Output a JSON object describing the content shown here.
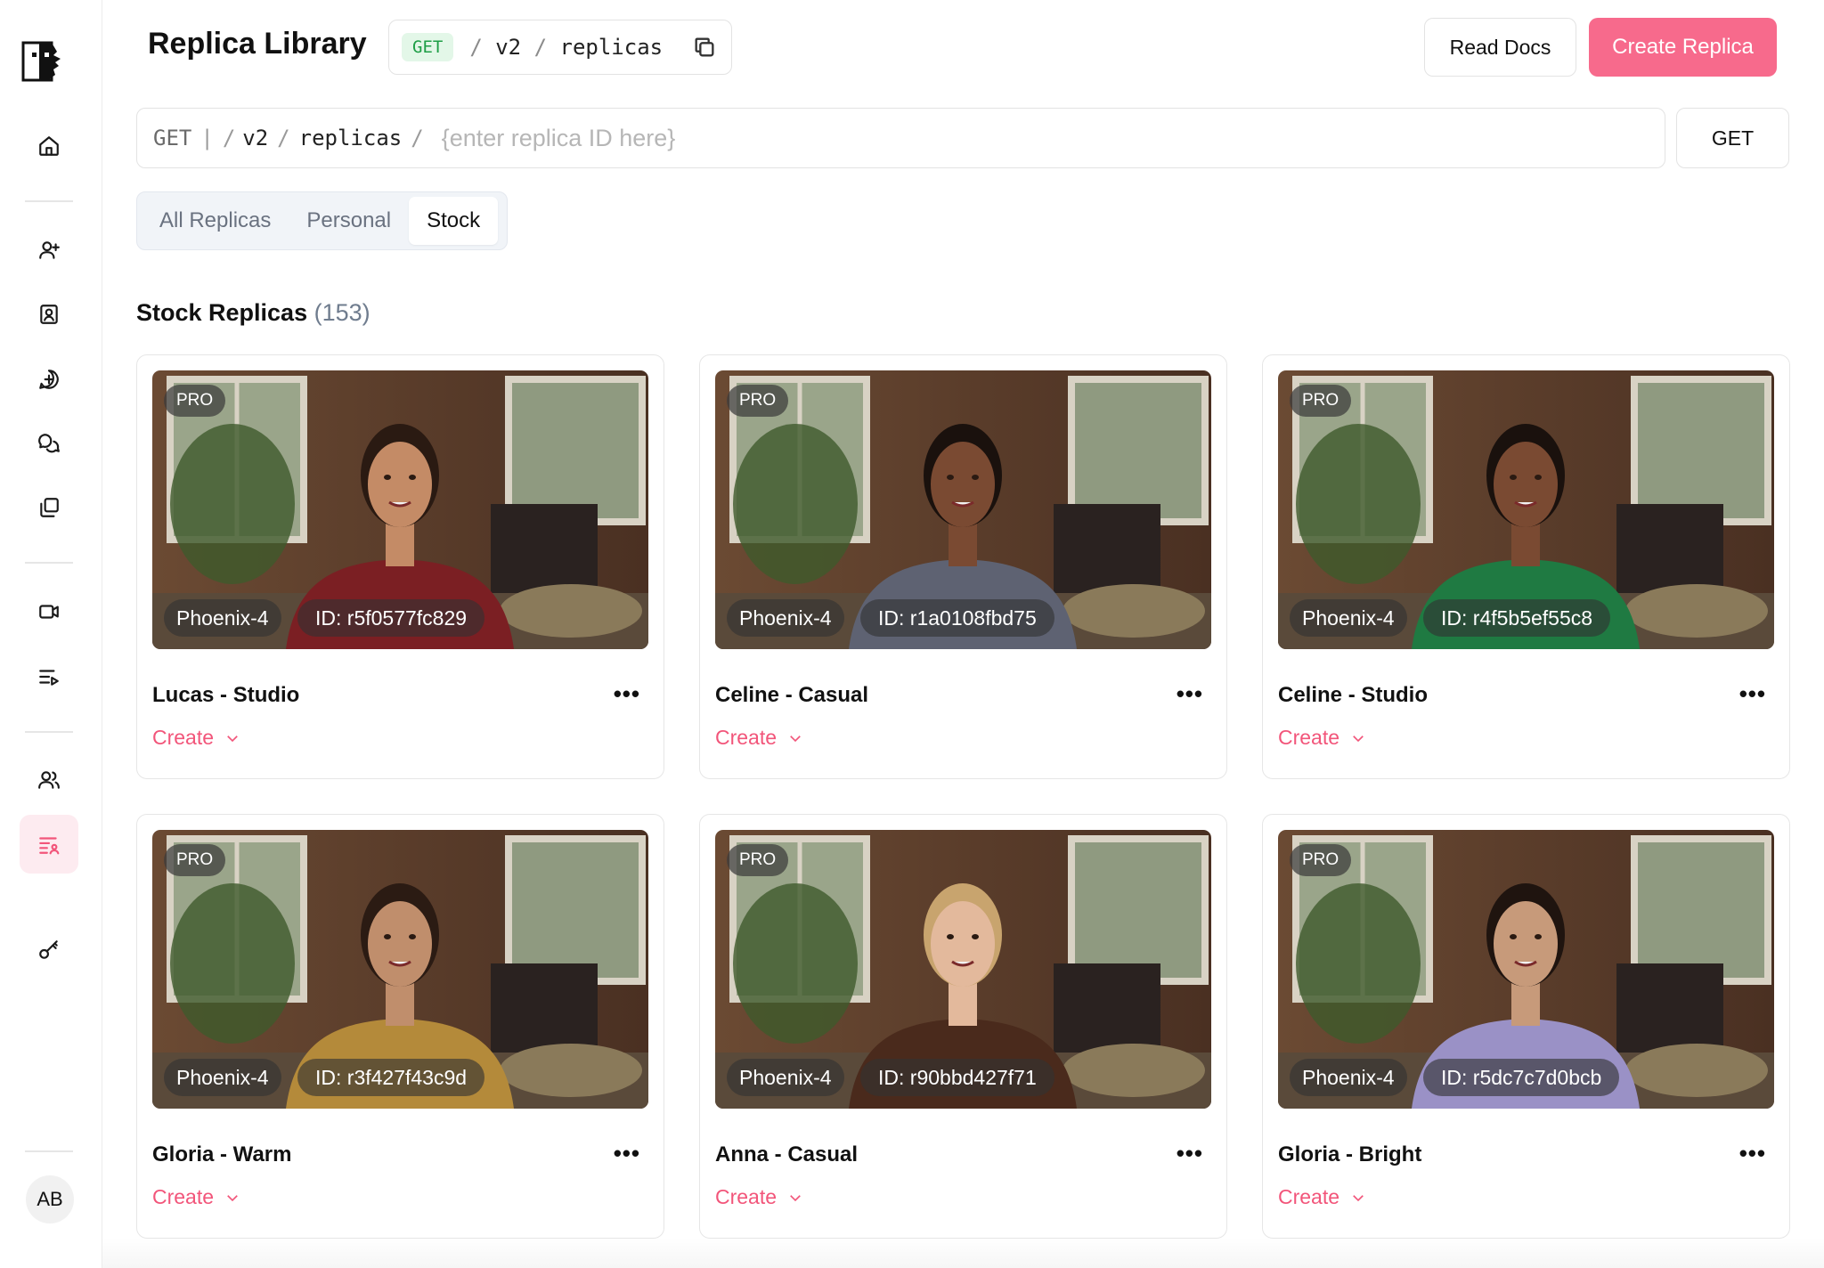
{
  "header": {
    "title": "Replica Library",
    "endpoint": {
      "method": "GET",
      "segments": [
        "v2",
        "replicas"
      ]
    },
    "read_docs_label": "Read Docs",
    "create_replica_label": "Create Replica"
  },
  "query": {
    "method": "GET",
    "pipe": "|",
    "segments": [
      "v2",
      "replicas"
    ],
    "placeholder": "{enter replica ID here}",
    "button_label": "GET"
  },
  "tabs": [
    {
      "label": "All Replicas",
      "active": false
    },
    {
      "label": "Personal",
      "active": false
    },
    {
      "label": "Stock",
      "active": true
    }
  ],
  "section": {
    "title": "Stock Replicas",
    "count": "(153)"
  },
  "cards": [
    {
      "name": "Lucas - Studio",
      "badge": "PRO",
      "model": "Phoenix-4",
      "id": "ID: r5f0577fc829",
      "create_label": "Create",
      "shirt": "#7b1f23",
      "skin": "#c48b66",
      "hair": "#2a1a12"
    },
    {
      "name": "Celine - Casual",
      "badge": "PRO",
      "model": "Phoenix-4",
      "id": "ID: r1a0108fbd75",
      "create_label": "Create",
      "shirt": "#5e6272",
      "skin": "#7a4a32",
      "hair": "#1a110d"
    },
    {
      "name": "Celine - Studio",
      "badge": "PRO",
      "model": "Phoenix-4",
      "id": "ID: r4f5b5ef55c8",
      "create_label": "Create",
      "shirt": "#1f7a42",
      "skin": "#7a4a32",
      "hair": "#1a110d"
    },
    {
      "name": "Gloria - Warm",
      "badge": "PRO",
      "model": "Phoenix-4",
      "id": "ID: r3f427f43c9d",
      "create_label": "Create",
      "shirt": "#b48a3a",
      "skin": "#c08e6c",
      "hair": "#2b1b13"
    },
    {
      "name": "Anna - Casual",
      "badge": "PRO",
      "model": "Phoenix-4",
      "id": "ID: r90bbd427f71",
      "create_label": "Create",
      "shirt": "#4a2a1c",
      "skin": "#e3b99c",
      "hair": "#c8a46e"
    },
    {
      "name": "Gloria - Bright",
      "badge": "PRO",
      "model": "Phoenix-4",
      "id": "ID: r5dc7c7d0bcb",
      "create_label": "Create",
      "shirt": "#9a91c6",
      "skin": "#c79a7a",
      "hair": "#1f140f"
    }
  ],
  "user": {
    "initials": "AB"
  },
  "colors": {
    "accent": "#f2557a",
    "button_primary": "#f76a8c",
    "get_badge_bg": "#e3f7e8",
    "get_badge_text": "#1e9e46"
  },
  "sidebar_icons": [
    "home-icon",
    "add-user-icon",
    "contact-card-icon",
    "plus-chat-icon",
    "conversations-icon",
    "copy-stack-icon",
    "video-icon",
    "playlist-icon",
    "users-icon",
    "replica-list-icon",
    "key-icon"
  ]
}
